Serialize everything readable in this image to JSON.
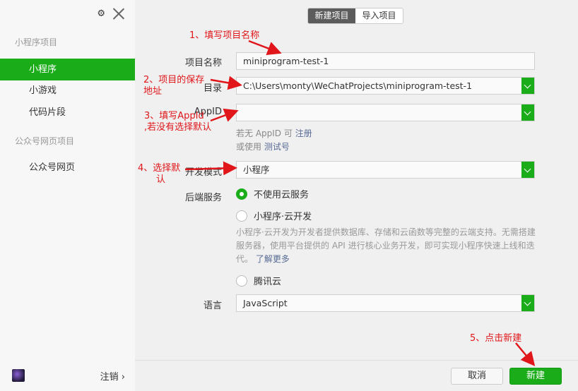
{
  "sidebar": {
    "gear_icon": "gear-icon",
    "close_icon": "close-icon",
    "section_mini": "小程序项目",
    "items_mini": [
      "小程序",
      "小游戏",
      "代码片段"
    ],
    "section_web": "公众号网页项目",
    "items_web": [
      "公众号网页"
    ],
    "logout": "注销 ›"
  },
  "tabs": {
    "new": "新建项目",
    "import": "导入项目"
  },
  "form": {
    "name_label": "项目名称",
    "name_value": "miniprogram-test-1",
    "dir_label": "目录",
    "dir_value": "C:\\Users\\monty\\WeChatProjects\\miniprogram-test-1",
    "appid_label": "AppID",
    "appid_value": "",
    "appid_hint_prefix": "若无 AppID 可",
    "appid_hint_register": "注册",
    "appid_hint_or": "或使用",
    "appid_hint_test": "测试号",
    "mode_label": "开发模式",
    "mode_value": "小程序",
    "backend_label": "后端服务",
    "backend_opt1": "不使用云服务",
    "backend_opt2": "小程序·云开发",
    "backend_desc": "小程序·云开发为开发者提供数据库、存储和云函数等完整的云端支持。无需搭建服务器，使用平台提供的 API 进行核心业务开发，即可实现小程序快速上线和迭代。",
    "backend_more": "了解更多",
    "backend_opt3": "腾讯云",
    "lang_label": "语言",
    "lang_value": "JavaScript"
  },
  "buttons": {
    "cancel": "取消",
    "create": "新建"
  },
  "annotations": {
    "a1": "1、填写项目名称",
    "a2_line1": "2、项目的保存",
    "a2_line2": "地址",
    "a3_line1": "3、填写AppId",
    "a3_line2": ",若没有选择默认",
    "a4_line1": "4、选择默",
    "a4_line2": "认",
    "a5": "5、点击新建"
  },
  "colors": {
    "accent": "#1aad19",
    "annotation": "#e0161a",
    "link": "#576b95"
  }
}
